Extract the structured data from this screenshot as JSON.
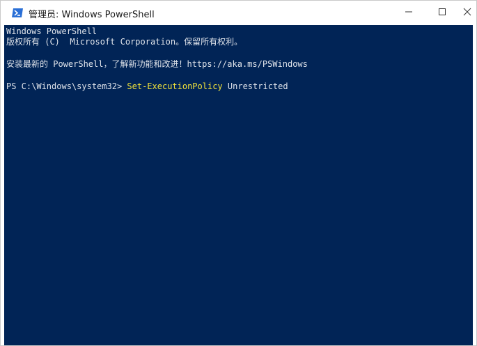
{
  "window": {
    "title": "管理员: Windows PowerShell",
    "icon": "powershell-icon",
    "controls": {
      "minimize": "minimize-icon",
      "maximize": "maximize-icon",
      "close": "close-icon"
    }
  },
  "terminal": {
    "background": "#012456",
    "lines": [
      "Windows PowerShell",
      "版权所有 (C)  Microsoft Corporation。保留所有权利。",
      "安装最新的 PowerShell，了解新功能和改进！https://aka.ms/PSWindows"
    ],
    "prompt": "PS C:\\Windows\\system32> ",
    "command": "Set-ExecutionPolicy",
    "command_arg": " Unrestricted",
    "command_color": "#f0e23a"
  }
}
